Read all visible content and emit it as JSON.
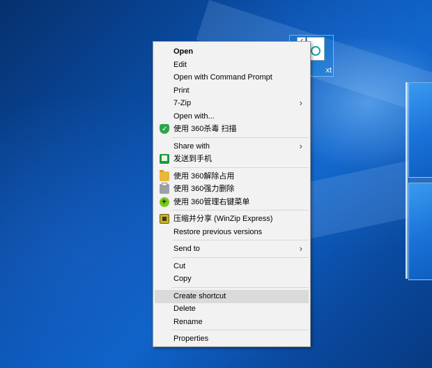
{
  "desktop": {
    "file": {
      "label": "xt",
      "checkbox": "✓"
    }
  },
  "context_menu": {
    "groups": [
      [
        {
          "label": "Open",
          "bold": true
        },
        {
          "label": "Edit"
        },
        {
          "label": "Open with Command Prompt"
        },
        {
          "label": "Print"
        },
        {
          "label": "7-Zip",
          "submenu": true
        },
        {
          "label": "Open with..."
        },
        {
          "label": "使用 360杀毒 扫描",
          "icon": "shield-360-icon"
        }
      ],
      [
        {
          "label": "Share with",
          "submenu": true
        },
        {
          "label": "发送到手机",
          "icon": "phone-send-icon"
        }
      ],
      [
        {
          "label": "使用 360解除占用",
          "icon": "folder-unlock-icon"
        },
        {
          "label": "使用 360强力删除",
          "icon": "shredder-icon"
        },
        {
          "label": "使用 360管理右键菜单",
          "icon": "green-menu-icon"
        }
      ],
      [
        {
          "label": "压缩并分享 (WinZip Express)",
          "icon": "winzip-icon"
        },
        {
          "label": "Restore previous versions"
        }
      ],
      [
        {
          "label": "Send to",
          "submenu": true
        }
      ],
      [
        {
          "label": "Cut"
        },
        {
          "label": "Copy"
        }
      ],
      [
        {
          "label": "Create shortcut",
          "highlighted": true
        },
        {
          "label": "Delete"
        },
        {
          "label": "Rename"
        }
      ],
      [
        {
          "label": "Properties"
        }
      ]
    ],
    "submenu_arrow": "›"
  },
  "colors": {
    "menu_bg": "#f2f2f2",
    "highlight": "#dadada",
    "desktop_blue": "#0b57b8"
  }
}
